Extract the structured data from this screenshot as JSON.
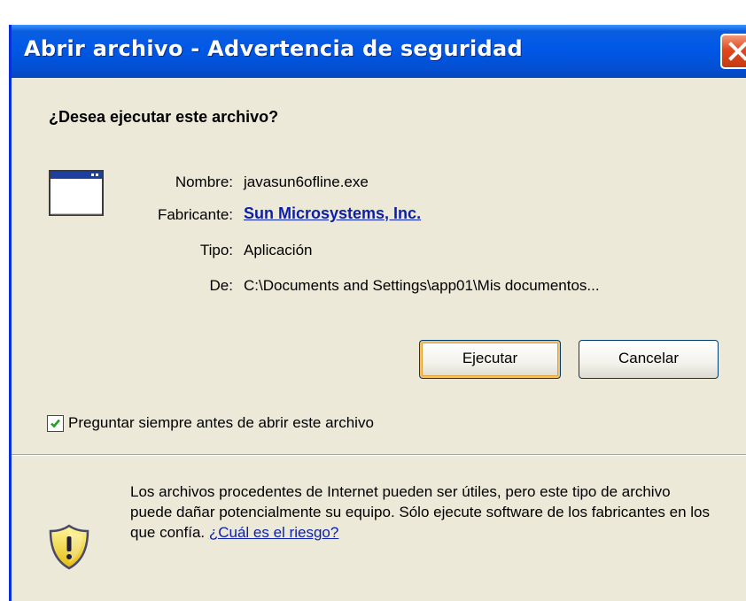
{
  "window": {
    "title": "Abrir archivo - Advertencia de seguridad",
    "close_icon": "close-icon"
  },
  "dialog": {
    "question": "¿Desea ejecutar este archivo?",
    "file_icon": "application-window-icon",
    "fields": {
      "name_label": "Nombre:",
      "name_value": "javasun6ofline.exe",
      "publisher_label": "Fabricante:",
      "publisher_value": "Sun Microsystems, Inc.",
      "type_label": "Tipo:",
      "type_value": "Aplicación",
      "from_label": "De:",
      "from_value": "C:\\Documents and Settings\\app01\\Mis documentos..."
    },
    "buttons": {
      "run": "Ejecutar",
      "cancel": "Cancelar"
    },
    "checkbox": {
      "label": "Preguntar siempre antes de abrir este archivo",
      "checked": true
    },
    "warning": {
      "icon": "security-shield-icon",
      "text": "Los archivos procedentes de Internet pueden ser útiles, pero este tipo de archivo puede dañar potencialmente su equipo. Sólo ejecute software de los fabricantes en los que confía.",
      "link": "¿Cuál es el riesgo?"
    }
  },
  "colors": {
    "titlebar": "#0058e6",
    "dialog_bg": "#ece9d8",
    "link": "#0b1fa8",
    "default_button_glow": "#f2c26b"
  }
}
